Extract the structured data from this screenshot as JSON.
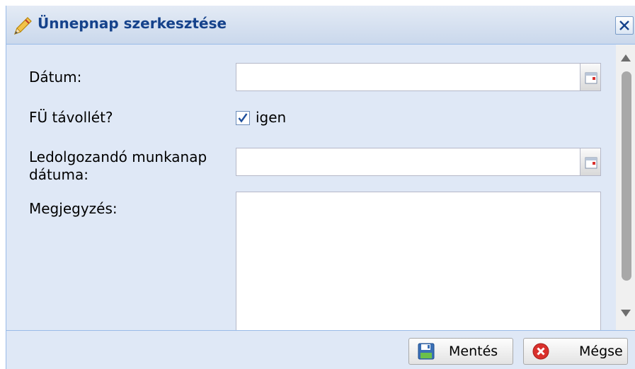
{
  "window": {
    "title": "Ünnepnap szerkesztése",
    "title_icon": "pencil-icon",
    "close_icon": "close-icon"
  },
  "form": {
    "date_label": "Dátum:",
    "date_value": "",
    "absence_label": "FÜ távollét?",
    "absence_checked": true,
    "absence_option": "igen",
    "workday_label_line1": "Ledolgozandó munkanap",
    "workday_label_line2": "dátuma:",
    "workday_value": "",
    "note_label": "Megjegyzés:",
    "note_value": "",
    "calendar_icon": "calendar-icon"
  },
  "buttons": {
    "save_label": "Mentés",
    "save_icon": "floppy-disk-icon",
    "cancel_label": "Mégse",
    "cancel_icon": "cancel-x-icon"
  },
  "colors": {
    "title_text": "#15428b",
    "panel_bg": "#dfe8f6",
    "border": "#99bbe8"
  }
}
